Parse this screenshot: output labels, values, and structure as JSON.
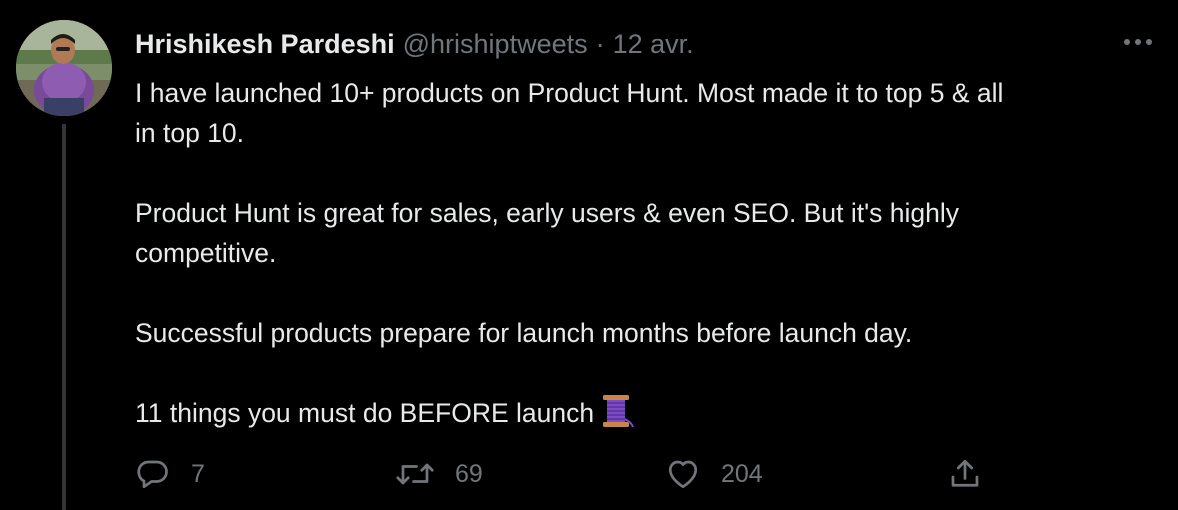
{
  "tweet": {
    "author": {
      "display_name": "Hrishikesh Pardeshi",
      "handle": "@hrishiptweets",
      "separator": "·",
      "date": "12 avr."
    },
    "paragraphs": [
      "I have launched 10+ products on Product Hunt. Most made it to top 5 & all\nin top 10.",
      "Product Hunt is great for sales, early users & even SEO. But it's highly\ncompetitive.",
      "Successful products prepare for launch months before launch day."
    ],
    "last_line": "11 things you must do BEFORE launch",
    "last_line_icon": "spool-of-thread-icon",
    "actions": {
      "reply_count": "7",
      "retweet_count": "69",
      "like_count": "204"
    },
    "icons": {
      "reply": "reply-icon",
      "retweet": "retweet-icon",
      "like": "heart-icon",
      "share": "share-icon",
      "more": "more-icon"
    }
  },
  "colors": {
    "background": "#000000",
    "text_primary": "#e7e9ea",
    "text_secondary": "#71767b",
    "thread_line": "#333639"
  }
}
